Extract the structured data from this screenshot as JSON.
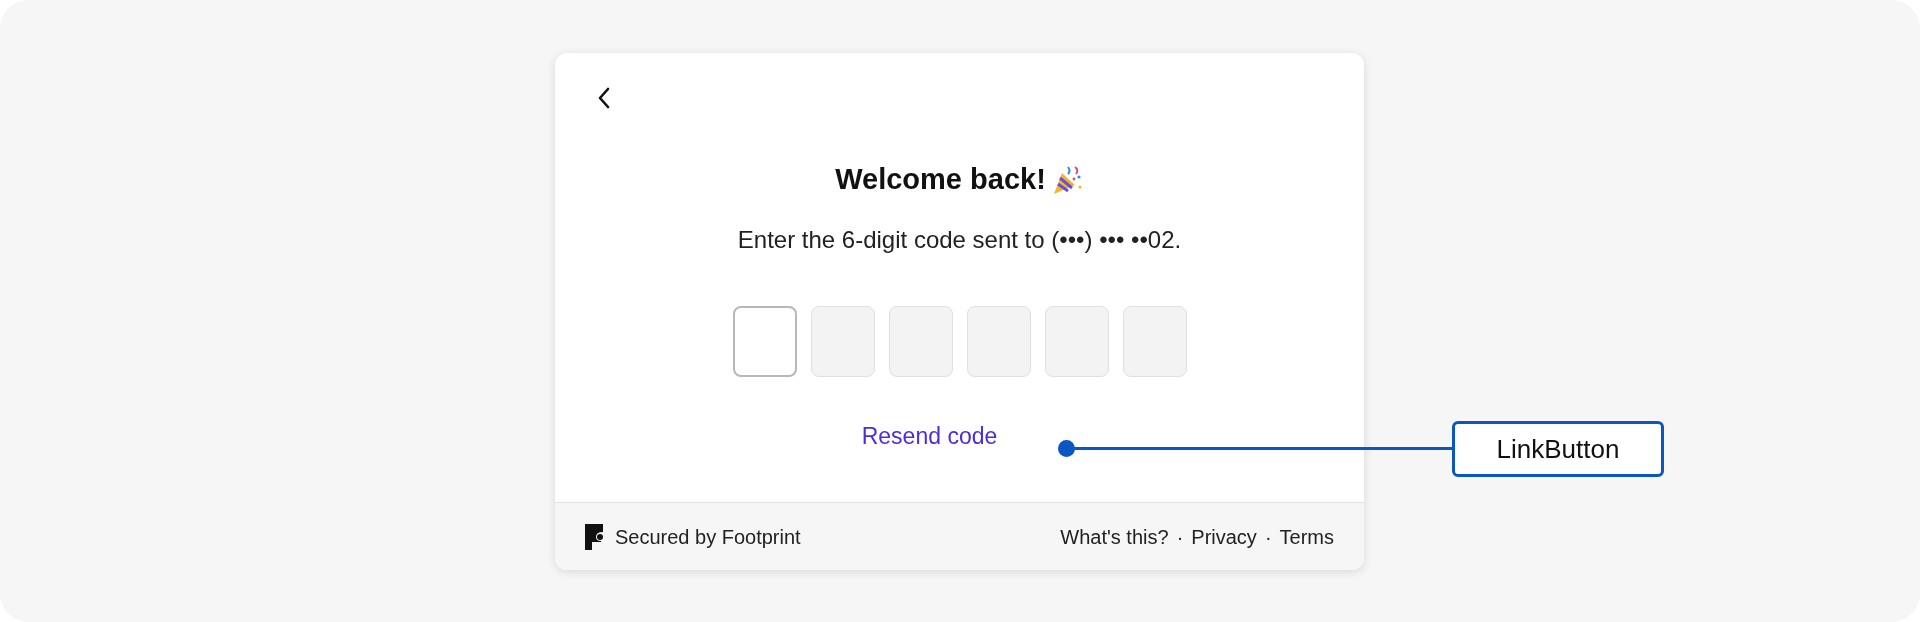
{
  "dialog": {
    "title": "Welcome back!",
    "subtitle": "Enter the 6-digit code sent to (•••) ••• ••02.",
    "code_boxes": [
      {
        "selected": true
      },
      {
        "selected": false
      },
      {
        "selected": false
      },
      {
        "selected": false
      },
      {
        "selected": false
      },
      {
        "selected": false
      }
    ],
    "resend_link": "Resend code",
    "footer": {
      "brand": "Secured by Footprint",
      "separator": "·",
      "links": [
        "What's this?",
        "Privacy",
        "Terms"
      ]
    }
  },
  "annotation": {
    "label": "LinkButton"
  }
}
